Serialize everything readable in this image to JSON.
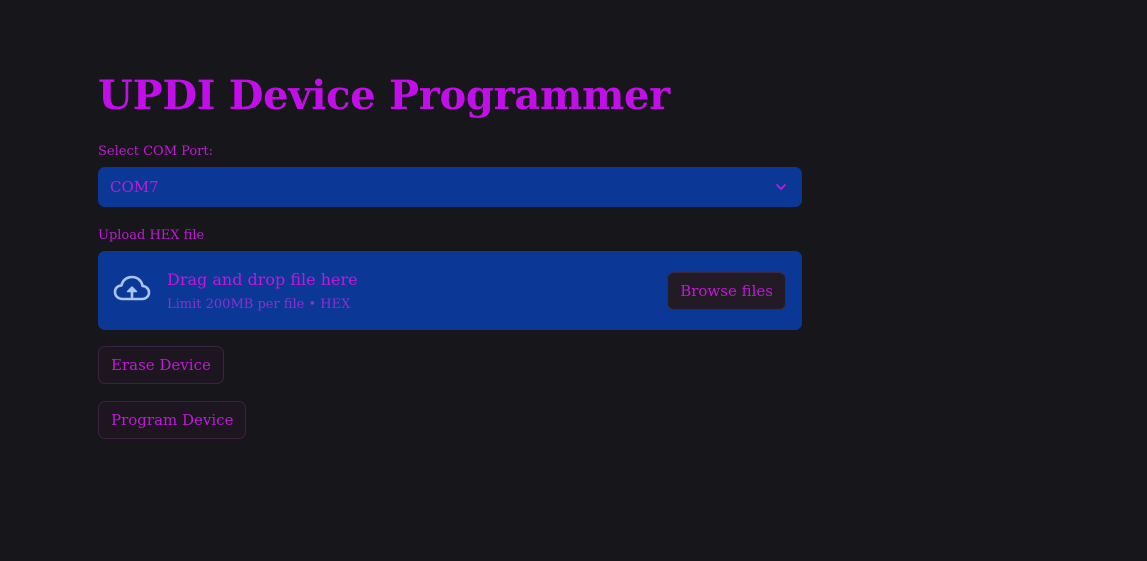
{
  "app": {
    "title": "UPDI Device Programmer"
  },
  "com_port": {
    "label": "Select COM Port:",
    "selected": "COM7",
    "icon": "chevron-down-icon"
  },
  "hex_upload": {
    "label": "Upload HEX file",
    "drop_text": "Drag and drop file here",
    "limit_text": "Limit 200MB per file • HEX",
    "browse_label": "Browse files",
    "icon": "cloud-upload-icon"
  },
  "actions": {
    "erase_label": "Erase Device",
    "program_label": "Program Device"
  },
  "colors": {
    "background": "#17161a",
    "accent": "#c20ee8",
    "input_bg": "#0b3896",
    "button_bg": "#1d1620"
  }
}
